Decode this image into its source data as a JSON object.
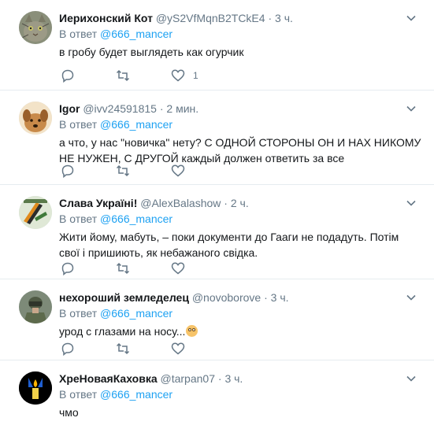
{
  "reply_prefix": "В ответ",
  "tweets": [
    {
      "name": "Иерихонский Кот",
      "handle": "@yS2VfMqnB2TCkE4",
      "time": "3 ч.",
      "reply_to": "@666_mancer",
      "text": "в гробу будет выглядеть как огурчик",
      "likes": "1",
      "avatar": "cat-avatar"
    },
    {
      "name": "Igor",
      "handle": "@ivv24591815",
      "time": "2 мин.",
      "reply_to": "@666_mancer",
      "text": "а что, у нас \"новичка\" нету? С ОДНОЙ СТОРОНЫ ОН И НАХ НИКОМУ НЕ НУЖЕН, С ДРУГОЙ каждый должен ответить за все",
      "likes": "",
      "avatar": "dog-avatar"
    },
    {
      "name": "Слава Україні!",
      "handle": "@AlexBalashow",
      "time": "2 ч.",
      "reply_to": "@666_mancer",
      "text": "Жити йому, мабуть, – поки документи до Гааги не подадуть. Потім свої і пришиють, як небажаного свідка.",
      "likes": "",
      "avatar": "ribbon-avatar"
    },
    {
      "name": "нехороший земледелец",
      "handle": "@novoborove",
      "time": "3 ч.",
      "reply_to": "@666_mancer",
      "text": "урод с глазами на носу...",
      "likes": "",
      "avatar": "soldier-avatar"
    },
    {
      "name": "ХреНоваяКаховка",
      "handle": "@tarpan07",
      "time": "3 ч.",
      "reply_to": "@666_mancer",
      "text": "чмо",
      "likes": "",
      "avatar": "candle-avatar"
    }
  ]
}
